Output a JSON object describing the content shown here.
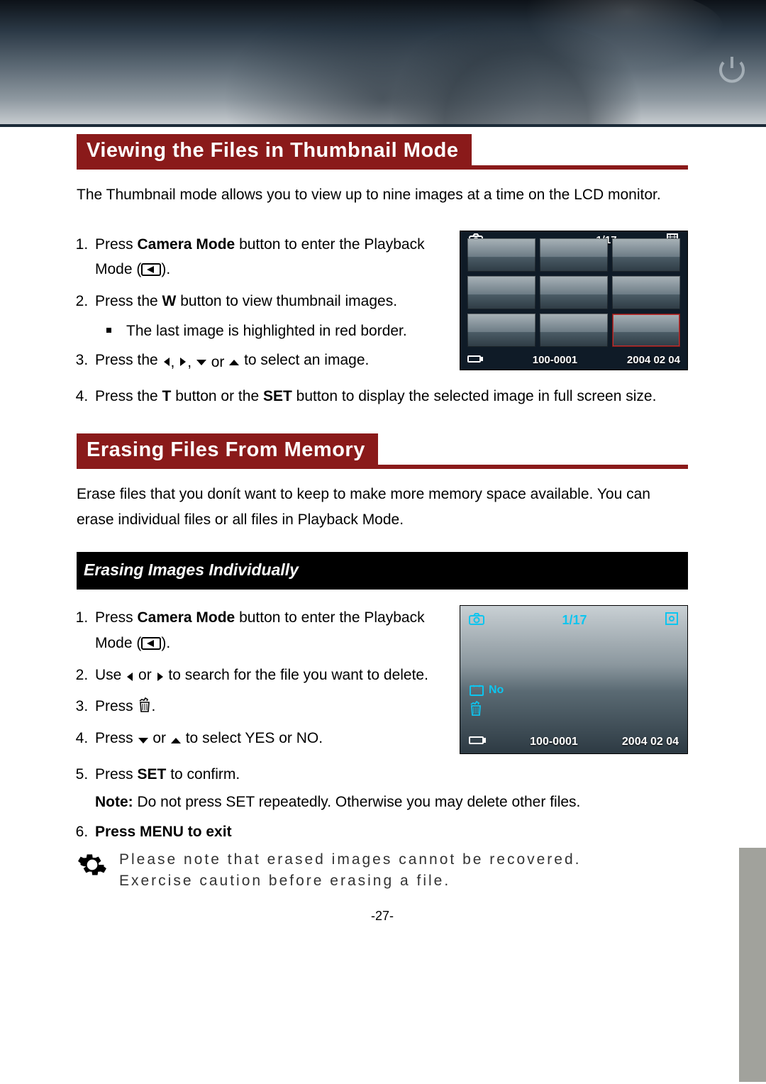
{
  "page_number": "-27-",
  "section1": {
    "title": "Viewing the Files in Thumbnail Mode",
    "intro": "The Thumbnail mode allows you to view up to nine images at a time on the LCD monitor.",
    "steps": {
      "s1a": "Press ",
      "s1b": "Camera Mode",
      "s1c": " button to enter the Playback Mode (",
      "s1d": ").",
      "s2a": "Press the ",
      "s2b": "W",
      "s2c": " button to view thumbnail images.",
      "s2_sub": "The last image is highlighted in red border.",
      "s3a": "Press the ",
      "s3b": " to select an image.",
      "s4a": "Press the ",
      "s4b": "T",
      "s4c": " button or the ",
      "s4d": "SET",
      "s4e": " button to display the selected image in full screen size."
    },
    "lcd": {
      "counter": "1/17",
      "file_number": "100-0001",
      "date": "2004 02 04"
    }
  },
  "section2": {
    "title": "Erasing Files From Memory",
    "intro": "Erase files that you donít want to keep to make more memory space available. You can erase individual files or all files in Playback Mode.",
    "subheading": "Erasing Images Individually",
    "steps": {
      "s1a": "Press ",
      "s1b": "Camera Mode",
      "s1c": " button to enter the Playback Mode (",
      "s1d": ").",
      "s2a": "Use ",
      "s2b": " or ",
      "s2c": " to search for the file you want to delete.",
      "s3a": "Press ",
      "s3b": ".",
      "s4a": "Press ",
      "s4b": " or ",
      "s4c": " to select YES or NO.",
      "s5a": "Press ",
      "s5b": "SET",
      "s5c": " to confirm.",
      "note_label": "Note:",
      "note_text": " Do not press SET repeatedly. Otherwise you may delete other files.",
      "s6": "Press MENU to exit"
    },
    "lcd": {
      "counter": "1/17",
      "no_label": "No",
      "file_number": "100-0001",
      "date": "2004 02 04"
    },
    "caution": {
      "line1": "Please note that erased images cannot be recovered.",
      "line2": "Exercise caution before erasing a file."
    }
  }
}
